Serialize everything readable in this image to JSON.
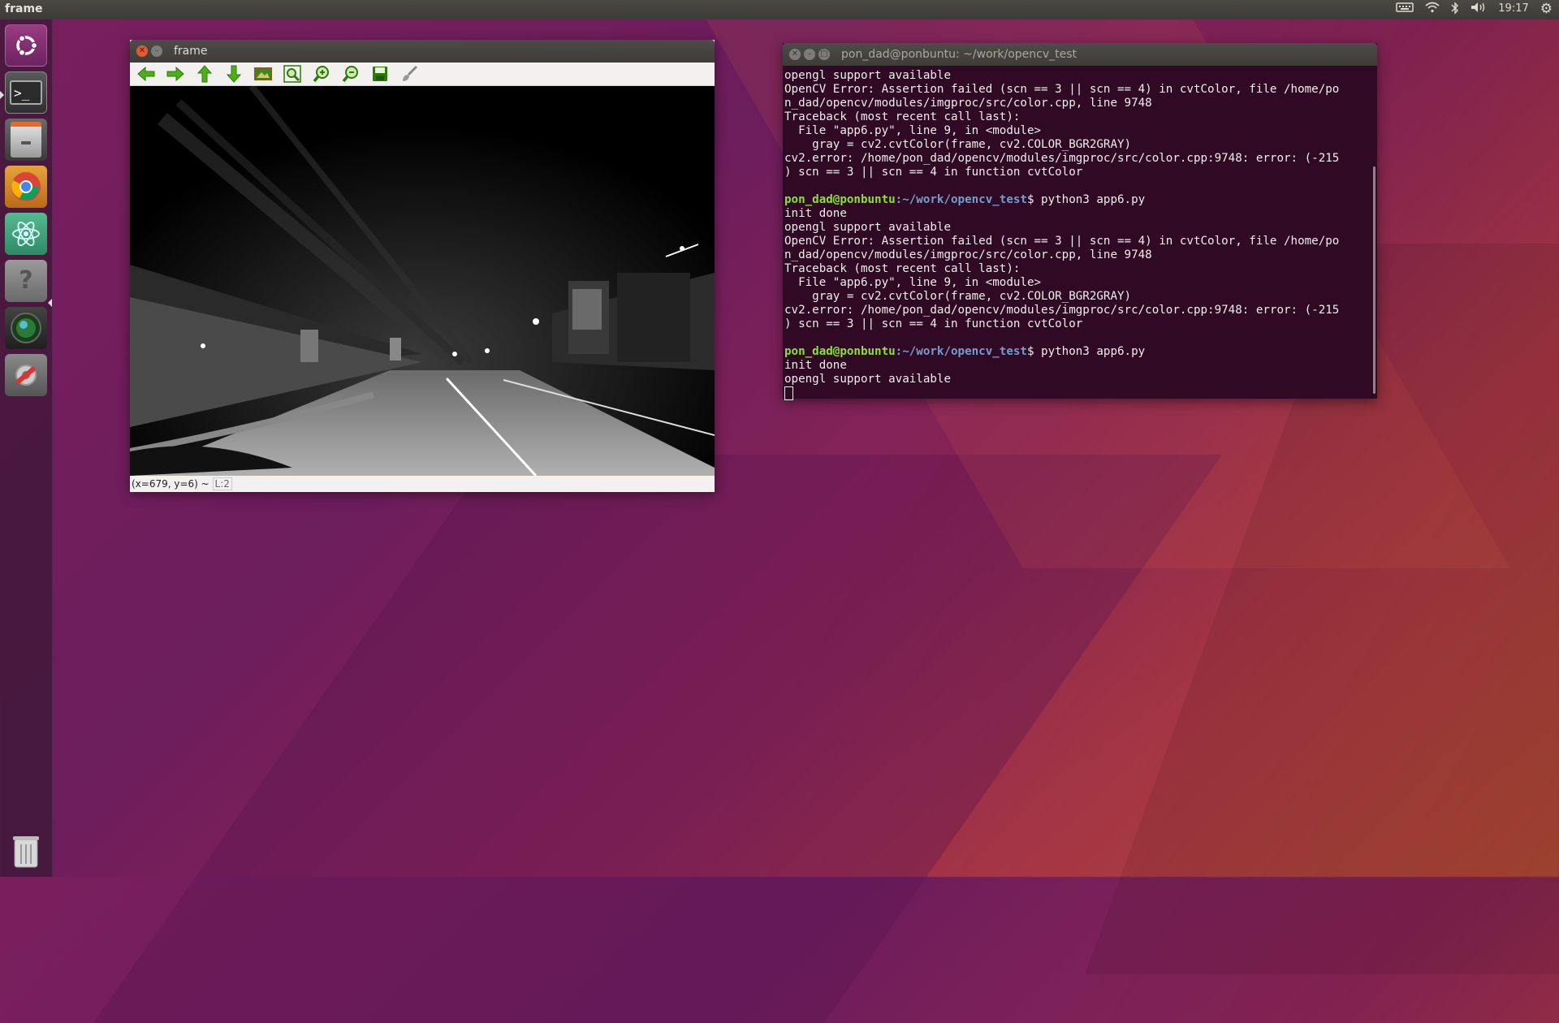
{
  "desktop": {
    "top_panel_title": "frame",
    "clock": "19:17"
  },
  "launcher": {
    "items": [
      "ubuntu-dash",
      "terminal",
      "files",
      "chrome",
      "atom",
      "help",
      "shotwell",
      "system-settings"
    ],
    "trash": "trash"
  },
  "frame_window": {
    "title": "frame",
    "toolbar": [
      "arrow-left-icon",
      "arrow-right-icon",
      "arrow-up-icon",
      "arrow-down-icon",
      "image-icon",
      "zoom-fit-icon",
      "zoom-in-icon",
      "zoom-out-icon",
      "save-icon",
      "brush-icon"
    ],
    "status": {
      "coords": "(x=679, y=6) ~ ",
      "level": "L:2"
    }
  },
  "terminal": {
    "title": "pon_dad@ponbuntu: ~/work/opencv_test",
    "lines": [
      {
        "t": "opengl support available"
      },
      {
        "t": "OpenCV Error: Assertion failed (scn == 3 || scn == 4) in cvtColor, file /home/po"
      },
      {
        "t": "n_dad/opencv/modules/imgproc/src/color.cpp, line 9748"
      },
      {
        "t": "Traceback (most recent call last):"
      },
      {
        "t": "  File \"app6.py\", line 9, in <module>"
      },
      {
        "t": "    gray = cv2.cvtColor(frame, cv2.COLOR_BGR2GRAY)"
      },
      {
        "t": "cv2.error: /home/pon_dad/opencv/modules/imgproc/src/color.cpp:9748: error: (-215"
      },
      {
        "t": ") scn == 3 || scn == 4 in function cvtColor"
      },
      {
        "t": ""
      },
      {
        "user": "pon_dad@ponbuntu",
        "path": ":~/work/opencv_test",
        "cmd": "$ python3 app6.py"
      },
      {
        "t": "init done"
      },
      {
        "t": "opengl support available"
      },
      {
        "t": "OpenCV Error: Assertion failed (scn == 3 || scn == 4) in cvtColor, file /home/po"
      },
      {
        "t": "n_dad/opencv/modules/imgproc/src/color.cpp, line 9748"
      },
      {
        "t": "Traceback (most recent call last):"
      },
      {
        "t": "  File \"app6.py\", line 9, in <module>"
      },
      {
        "t": "    gray = cv2.cvtColor(frame, cv2.COLOR_BGR2GRAY)"
      },
      {
        "t": "cv2.error: /home/pon_dad/opencv/modules/imgproc/src/color.cpp:9748: error: (-215"
      },
      {
        "t": ") scn == 3 || scn == 4 in function cvtColor"
      },
      {
        "t": ""
      },
      {
        "user": "pon_dad@ponbuntu",
        "path": ":~/work/opencv_test",
        "cmd": "$ python3 app6.py"
      },
      {
        "t": "init done"
      },
      {
        "t": "opengl support available"
      }
    ]
  },
  "colors": {
    "prompt_user": "#8ae234",
    "prompt_path": "#729fcf",
    "terminal_bg": "#300a24",
    "close_button": "#e45a35"
  }
}
